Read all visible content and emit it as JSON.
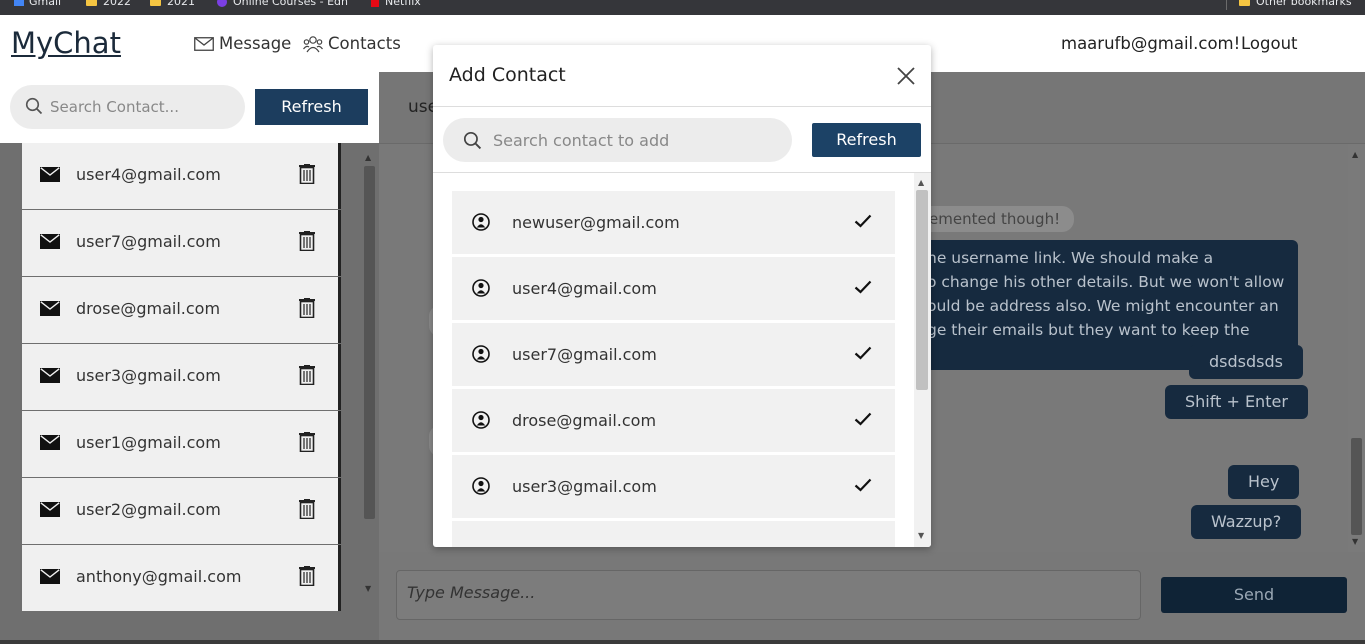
{
  "browser": {
    "bookmarks": [
      "Gmail",
      "2022",
      "2021",
      "Online Courses - Edh",
      "Netflix"
    ],
    "other_bookmarks": "Other bookmarks"
  },
  "header": {
    "logo": "MyChat",
    "nav": [
      {
        "icon": "envelope-icon",
        "label": "Message"
      },
      {
        "icon": "contacts-icon",
        "label": "Contacts"
      }
    ],
    "user_email": "maarufb@gmail.com!",
    "logout_label": "Logout"
  },
  "sidebar": {
    "search_placeholder": "Search Contact...",
    "refresh_label": "Refresh",
    "contacts": [
      "user4@gmail.com",
      "user7@gmail.com",
      "drose@gmail.com",
      "user3@gmail.com",
      "user1@gmail.com",
      "user2@gmail.com",
      "anthony@gmail.com"
    ]
  },
  "chat": {
    "header_partial": "use",
    "partial_gray_message": "emented though!",
    "long_message_lines": [
      "he username link. We should make a",
      "o change his other details. But we won't allow",
      "ould be address also. We might encounter an",
      "ge their emails but they want to keep the"
    ],
    "right_messages": [
      "dsdsdsds",
      "Shift + Enter",
      "Hey",
      "Wazzup?"
    ],
    "input_placeholder": "Type Message...",
    "send_label": "Send"
  },
  "modal": {
    "title": "Add Contact",
    "search_placeholder": "Search contact to add",
    "refresh_label": "Refresh",
    "results": [
      "newuser@gmail.com",
      "user4@gmail.com",
      "user7@gmail.com",
      "drose@gmail.com",
      "user3@gmail.com"
    ]
  }
}
